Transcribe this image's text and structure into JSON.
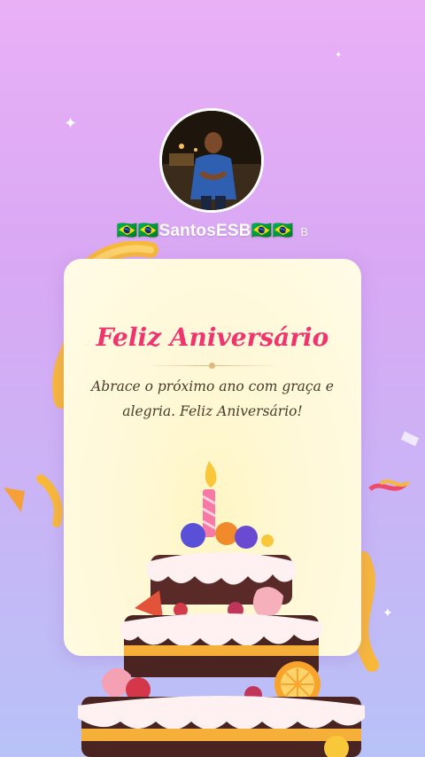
{
  "profile": {
    "username": "🇧🇷🇧🇷SantosESB🇧🇷🇧🇷",
    "badge": "B"
  },
  "card": {
    "title": "Feliz Aniversário",
    "message": "Abrace o próximo ano com graça e alegria. Feliz Aniversário!"
  },
  "theme": {
    "title_color": "#f0346e",
    "background_top": "#e9b0f6",
    "background_bottom": "#b8c2f7",
    "card_color": "#fff8d8"
  }
}
